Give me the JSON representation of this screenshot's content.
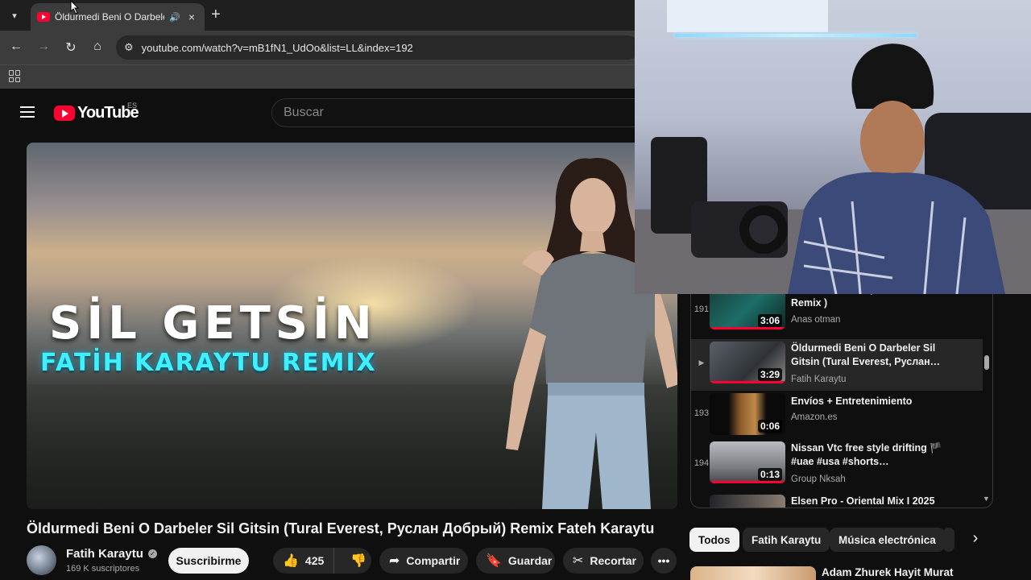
{
  "browser": {
    "tab_title": "Öldurmedi Beni O Darbeler",
    "url": "youtube.com/watch?v=mB1fN1_UdOo&list=LL&index=192"
  },
  "youtube": {
    "logo_text": "YouTube",
    "country_code": "ES",
    "search_placeholder": "Buscar"
  },
  "video": {
    "overlay_title": "SİL GETSİN",
    "overlay_subtitle": "FATİH KARAYTU REMIX",
    "title": "Öldurmedi Beni O Darbeler Sil Gitsin (Tural Everest, Руслан Добрый) Remix Fateh Karaytu",
    "channel": "Fatih Karaytu",
    "subscribers": "169 K suscriptores",
    "subscribe_label": "Suscribirme",
    "likes": "425",
    "share_label": "Compartir",
    "save_label": "Guardar",
    "clip_label": "Recortar"
  },
  "playlist": [
    {
      "index": "191",
      "title": "Otilia - Deli Gibi (Anas otman Remix )",
      "channel": "Anas otman",
      "duration": "3:06",
      "active": false
    },
    {
      "index": "▶",
      "title": "Öldurmedi Beni O Darbeler Sil Gitsin (Tural Everest, Руслан…",
      "channel": "Fatih Karaytu",
      "duration": "3:29",
      "active": true
    },
    {
      "index": "193",
      "title": "Envíos + Entretenimiento",
      "channel": "Amazon.es",
      "duration": "0:06",
      "active": false
    },
    {
      "index": "194",
      "title": "Nissan Vtc free style drifting 🏴 #uae #usa #shorts…",
      "channel": "Group Nksah",
      "duration": "0:13",
      "active": false
    },
    {
      "index": "",
      "title": "Elsen Pro - Oriental Mix I 2025",
      "channel": "",
      "duration": "",
      "active": false
    }
  ],
  "chips": [
    "Todos",
    "Fatih Karaytu",
    "Música electrónica"
  ],
  "next_recommendation": {
    "title": "Adam  Zhurek  Hayit Murat"
  },
  "colors": {
    "accent": "#ff0033",
    "background": "#0f0f0f",
    "chip_bg": "#272727"
  }
}
